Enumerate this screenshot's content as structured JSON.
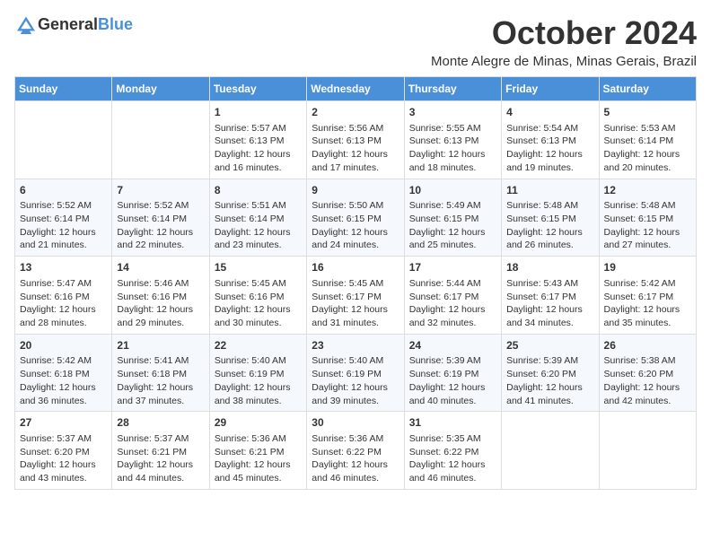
{
  "logo": {
    "text_general": "General",
    "text_blue": "Blue"
  },
  "title": {
    "month": "October 2024",
    "location": "Monte Alegre de Minas, Minas Gerais, Brazil"
  },
  "headers": [
    "Sunday",
    "Monday",
    "Tuesday",
    "Wednesday",
    "Thursday",
    "Friday",
    "Saturday"
  ],
  "weeks": [
    [
      {
        "day": "",
        "info": ""
      },
      {
        "day": "",
        "info": ""
      },
      {
        "day": "1",
        "info": "Sunrise: 5:57 AM\nSunset: 6:13 PM\nDaylight: 12 hours and 16 minutes."
      },
      {
        "day": "2",
        "info": "Sunrise: 5:56 AM\nSunset: 6:13 PM\nDaylight: 12 hours and 17 minutes."
      },
      {
        "day": "3",
        "info": "Sunrise: 5:55 AM\nSunset: 6:13 PM\nDaylight: 12 hours and 18 minutes."
      },
      {
        "day": "4",
        "info": "Sunrise: 5:54 AM\nSunset: 6:13 PM\nDaylight: 12 hours and 19 minutes."
      },
      {
        "day": "5",
        "info": "Sunrise: 5:53 AM\nSunset: 6:14 PM\nDaylight: 12 hours and 20 minutes."
      }
    ],
    [
      {
        "day": "6",
        "info": "Sunrise: 5:52 AM\nSunset: 6:14 PM\nDaylight: 12 hours and 21 minutes."
      },
      {
        "day": "7",
        "info": "Sunrise: 5:52 AM\nSunset: 6:14 PM\nDaylight: 12 hours and 22 minutes."
      },
      {
        "day": "8",
        "info": "Sunrise: 5:51 AM\nSunset: 6:14 PM\nDaylight: 12 hours and 23 minutes."
      },
      {
        "day": "9",
        "info": "Sunrise: 5:50 AM\nSunset: 6:15 PM\nDaylight: 12 hours and 24 minutes."
      },
      {
        "day": "10",
        "info": "Sunrise: 5:49 AM\nSunset: 6:15 PM\nDaylight: 12 hours and 25 minutes."
      },
      {
        "day": "11",
        "info": "Sunrise: 5:48 AM\nSunset: 6:15 PM\nDaylight: 12 hours and 26 minutes."
      },
      {
        "day": "12",
        "info": "Sunrise: 5:48 AM\nSunset: 6:15 PM\nDaylight: 12 hours and 27 minutes."
      }
    ],
    [
      {
        "day": "13",
        "info": "Sunrise: 5:47 AM\nSunset: 6:16 PM\nDaylight: 12 hours and 28 minutes."
      },
      {
        "day": "14",
        "info": "Sunrise: 5:46 AM\nSunset: 6:16 PM\nDaylight: 12 hours and 29 minutes."
      },
      {
        "day": "15",
        "info": "Sunrise: 5:45 AM\nSunset: 6:16 PM\nDaylight: 12 hours and 30 minutes."
      },
      {
        "day": "16",
        "info": "Sunrise: 5:45 AM\nSunset: 6:17 PM\nDaylight: 12 hours and 31 minutes."
      },
      {
        "day": "17",
        "info": "Sunrise: 5:44 AM\nSunset: 6:17 PM\nDaylight: 12 hours and 32 minutes."
      },
      {
        "day": "18",
        "info": "Sunrise: 5:43 AM\nSunset: 6:17 PM\nDaylight: 12 hours and 34 minutes."
      },
      {
        "day": "19",
        "info": "Sunrise: 5:42 AM\nSunset: 6:17 PM\nDaylight: 12 hours and 35 minutes."
      }
    ],
    [
      {
        "day": "20",
        "info": "Sunrise: 5:42 AM\nSunset: 6:18 PM\nDaylight: 12 hours and 36 minutes."
      },
      {
        "day": "21",
        "info": "Sunrise: 5:41 AM\nSunset: 6:18 PM\nDaylight: 12 hours and 37 minutes."
      },
      {
        "day": "22",
        "info": "Sunrise: 5:40 AM\nSunset: 6:19 PM\nDaylight: 12 hours and 38 minutes."
      },
      {
        "day": "23",
        "info": "Sunrise: 5:40 AM\nSunset: 6:19 PM\nDaylight: 12 hours and 39 minutes."
      },
      {
        "day": "24",
        "info": "Sunrise: 5:39 AM\nSunset: 6:19 PM\nDaylight: 12 hours and 40 minutes."
      },
      {
        "day": "25",
        "info": "Sunrise: 5:39 AM\nSunset: 6:20 PM\nDaylight: 12 hours and 41 minutes."
      },
      {
        "day": "26",
        "info": "Sunrise: 5:38 AM\nSunset: 6:20 PM\nDaylight: 12 hours and 42 minutes."
      }
    ],
    [
      {
        "day": "27",
        "info": "Sunrise: 5:37 AM\nSunset: 6:20 PM\nDaylight: 12 hours and 43 minutes."
      },
      {
        "day": "28",
        "info": "Sunrise: 5:37 AM\nSunset: 6:21 PM\nDaylight: 12 hours and 44 minutes."
      },
      {
        "day": "29",
        "info": "Sunrise: 5:36 AM\nSunset: 6:21 PM\nDaylight: 12 hours and 45 minutes."
      },
      {
        "day": "30",
        "info": "Sunrise: 5:36 AM\nSunset: 6:22 PM\nDaylight: 12 hours and 46 minutes."
      },
      {
        "day": "31",
        "info": "Sunrise: 5:35 AM\nSunset: 6:22 PM\nDaylight: 12 hours and 46 minutes."
      },
      {
        "day": "",
        "info": ""
      },
      {
        "day": "",
        "info": ""
      }
    ]
  ]
}
